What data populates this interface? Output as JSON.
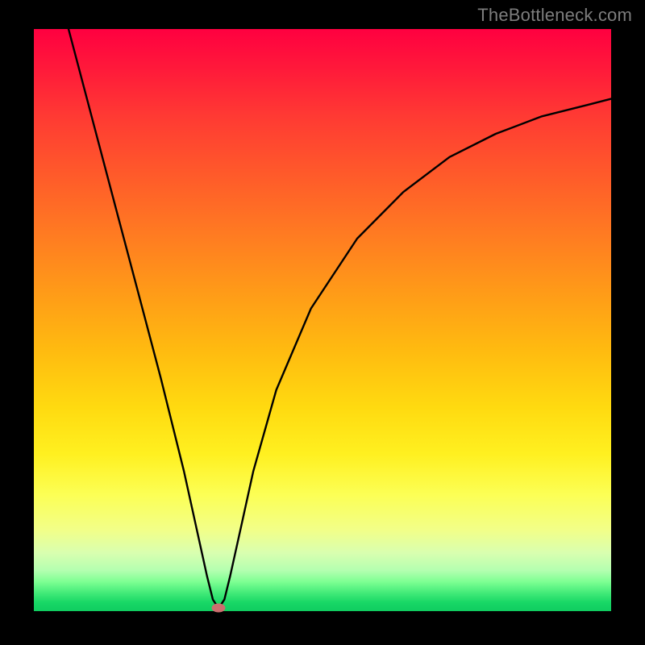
{
  "watermark": "TheBottleneck.com",
  "chart_data": {
    "type": "line",
    "title": "",
    "xlabel": "",
    "ylabel": "",
    "xlim": [
      0,
      100
    ],
    "ylim": [
      0,
      100
    ],
    "grid": false,
    "legend": false,
    "series": [
      {
        "name": "bottleneck-curve",
        "x": [
          6,
          10,
          14,
          18,
          22,
          26,
          28,
          30,
          31,
          32,
          33,
          34,
          36,
          38,
          42,
          48,
          56,
          64,
          72,
          80,
          88,
          96,
          100
        ],
        "y": [
          100,
          85,
          70,
          55,
          40,
          24,
          15,
          6,
          2,
          0.5,
          2,
          6,
          15,
          24,
          38,
          52,
          64,
          72,
          78,
          82,
          85,
          87,
          88
        ]
      }
    ],
    "annotations": [
      {
        "name": "optimal-point",
        "x": 32,
        "y": 0.5,
        "shape": "ellipse",
        "color": "#cc6e6e"
      }
    ],
    "background_gradient": {
      "direction": "vertical-top-to-bottom",
      "stops": [
        {
          "pos": 0,
          "color": "#ff0040"
        },
        {
          "pos": 50,
          "color": "#ff9a18"
        },
        {
          "pos": 80,
          "color": "#fcff55"
        },
        {
          "pos": 100,
          "color": "#10cc60"
        }
      ]
    }
  }
}
